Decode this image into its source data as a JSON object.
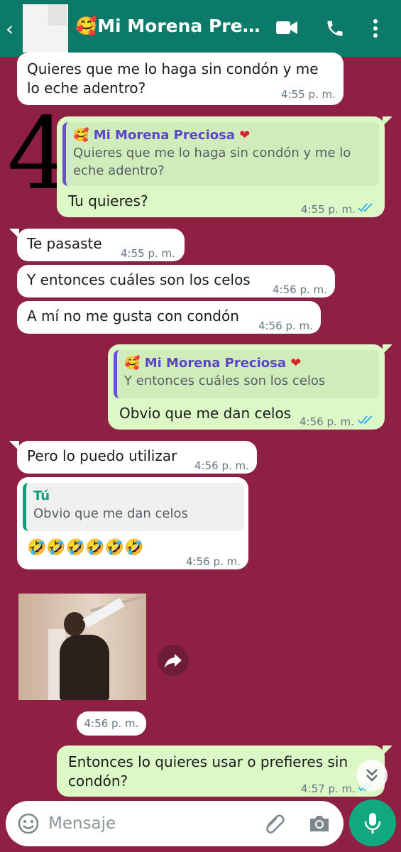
{
  "header": {
    "title": "🥰Mi Morena Precio…",
    "back_icon": "back-arrow-icon",
    "icons": [
      "video-call-icon",
      "voice-call-icon",
      "more-options-icon"
    ]
  },
  "annotation": {
    "number": "4"
  },
  "messages": [
    {
      "id": "m1",
      "direction": "in",
      "lines": [
        "Quieres que me lo haga sin condón y me",
        "lo eche adentro?"
      ],
      "time": "4:55 p. m."
    },
    {
      "id": "m2",
      "direction": "out",
      "quote_author": "Mi Morena Preciosa",
      "quote_emoji": "🥰",
      "quote_heart": "❤",
      "quote_lines": [
        "Quieres que me lo haga sin condón y me lo",
        "eche adentro?"
      ],
      "text": "Tu quieres?",
      "time": "4:55 p. m.",
      "status": "read"
    },
    {
      "id": "m3",
      "direction": "in",
      "text": "Te pasaste",
      "time": "4:55 p. m."
    },
    {
      "id": "m4",
      "direction": "in",
      "text": "Y entonces cuáles son los celos",
      "time": "4:56 p. m."
    },
    {
      "id": "m5",
      "direction": "in",
      "text": "A mí no me gusta con condón",
      "time": "4:56 p. m."
    },
    {
      "id": "m6",
      "direction": "out",
      "quote_author": "Mi Morena Preciosa",
      "quote_emoji": "🥰",
      "quote_heart": "❤",
      "quote_text": "Y entonces cuáles son los celos",
      "text": "Obvio que me dan celos",
      "time": "4:56 p. m.",
      "status": "read"
    },
    {
      "id": "m7",
      "direction": "in",
      "text": "Pero lo puedo utilizar",
      "time": "4:56 p. m."
    },
    {
      "id": "m8",
      "direction": "in",
      "quote_author": "Tú",
      "quote_text": "Obvio que me dan celos",
      "text": "🤣🤣🤣🤣🤣🤣",
      "time": "4:56 p. m."
    },
    {
      "id": "m9",
      "direction": "in",
      "type": "image",
      "time": "4:56 p. m."
    },
    {
      "id": "m10",
      "direction": "out",
      "lines": [
        "Entonces lo quieres usar o prefieres sin",
        "condón?"
      ],
      "time": "4:57 p. m.",
      "status": "read"
    }
  ],
  "input": {
    "placeholder": "Mensaje",
    "value": ""
  },
  "colors": {
    "header": "#0b7a68",
    "wallpaper": "#8e2044",
    "outgoing": "#dcf8c6",
    "incoming": "#ffffff",
    "mic": "#12a87e",
    "read_ticks": "#34b7f1"
  }
}
